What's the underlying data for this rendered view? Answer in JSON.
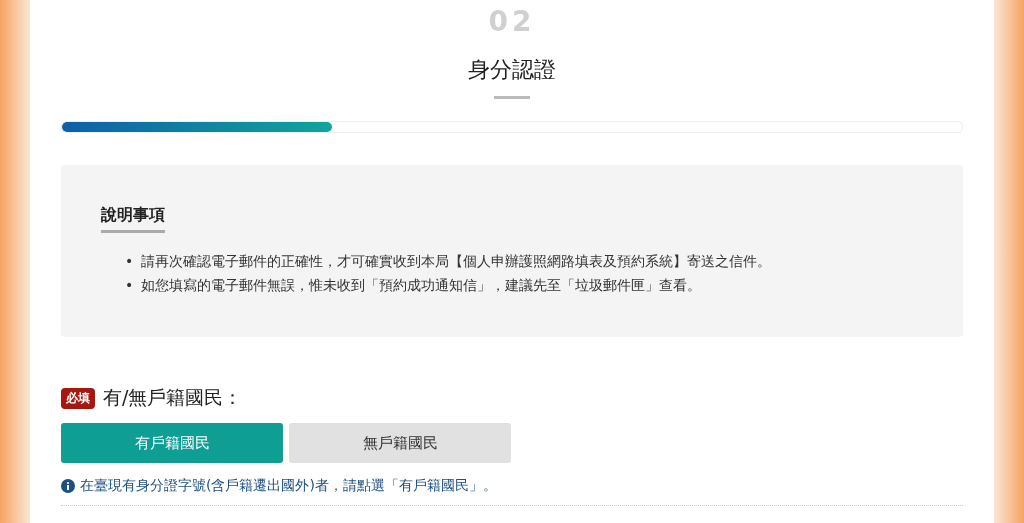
{
  "step": {
    "number": "02",
    "title": "身分認證",
    "level": 0.3
  },
  "notice": {
    "heading": "說明事項",
    "items": [
      {
        "bullet": "•",
        "text": "請再次確認電子郵件的正確性，才可確實收到本局【個人申辦護照網路填表及預約系統】寄送之信件。"
      },
      {
        "bullet": "•",
        "text": "如您填寫的電子郵件無誤，惟未收到「預約成功通知信」，建議先至「垃圾郵件匣」查看。"
      }
    ]
  },
  "field": {
    "required_badge": "必填",
    "label": "有/無戶籍國民：",
    "options": [
      {
        "label": "有戶籍國民",
        "selected": true
      },
      {
        "label": "無戶籍國民",
        "selected": false
      }
    ],
    "hint": "在臺現有身分證字號(含戶籍遷出國外)者，請點選「有戶籍國民」。"
  }
}
